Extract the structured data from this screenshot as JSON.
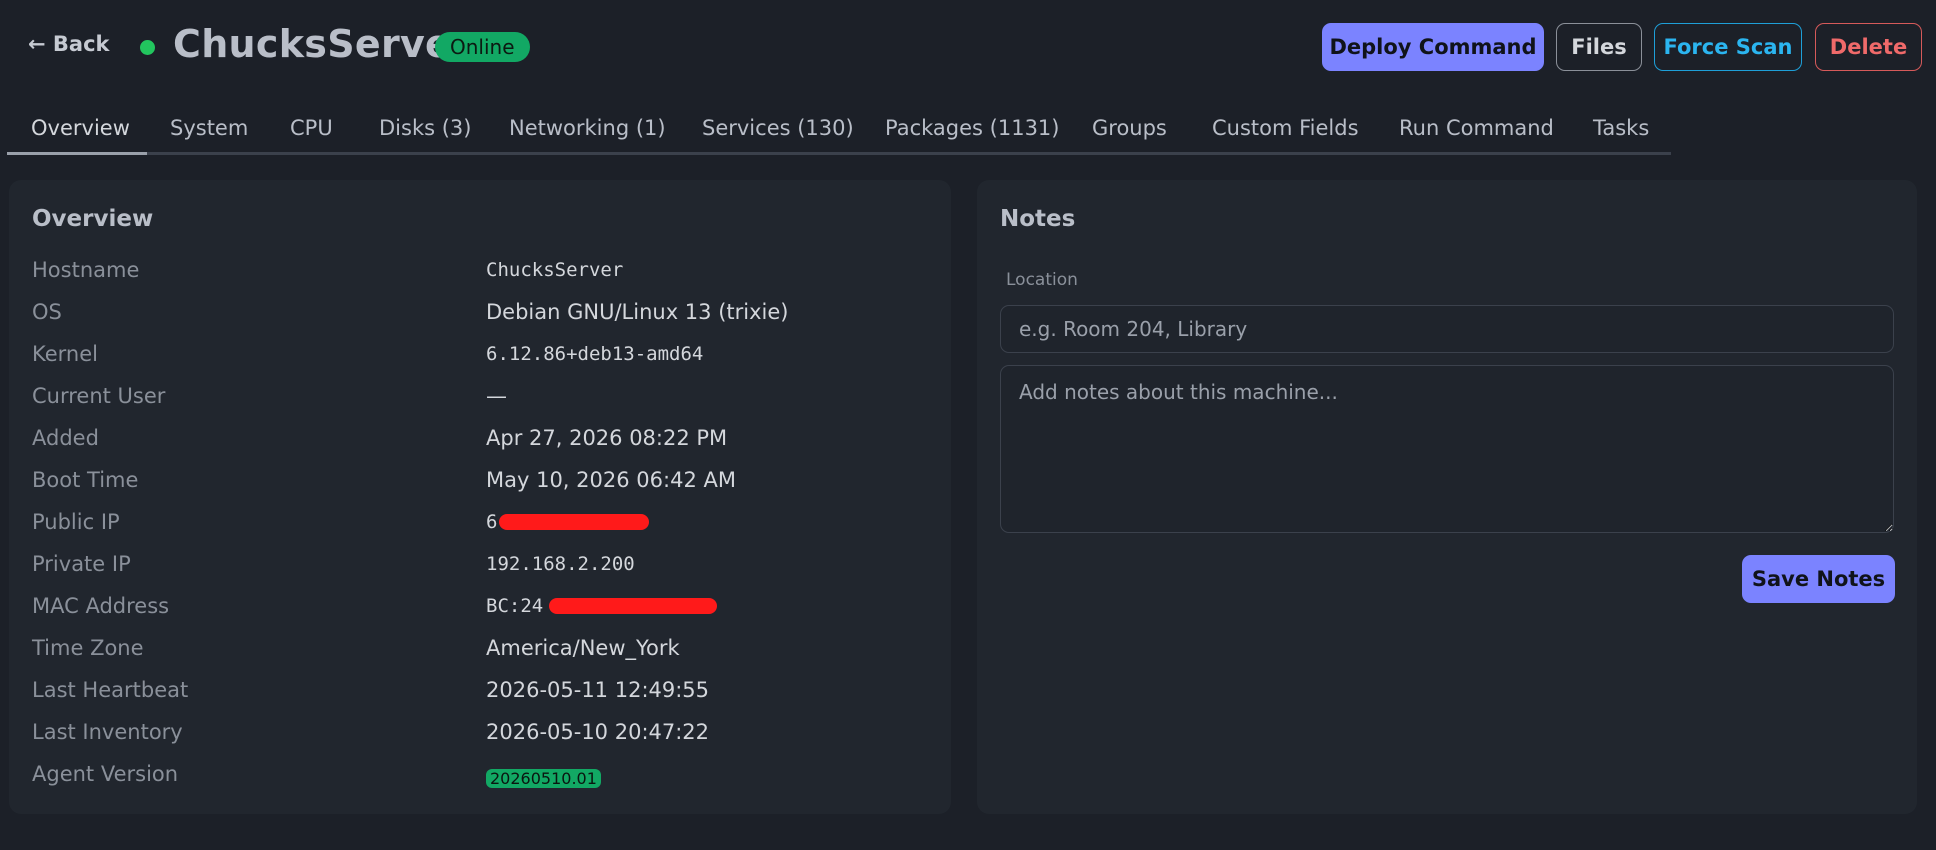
{
  "header": {
    "back_label": "← Back",
    "machine_name": "ChucksServer",
    "status": "Online",
    "status_color": "#22c55e",
    "actions": {
      "deploy": "Deploy Command",
      "files": "Files",
      "scan": "Force Scan",
      "delete": "Delete"
    }
  },
  "tabs": [
    {
      "label": "Overview",
      "active": true
    },
    {
      "label": "System"
    },
    {
      "label": "CPU"
    },
    {
      "label": "Disks (3)"
    },
    {
      "label": "Networking (1)"
    },
    {
      "label": "Services (130)"
    },
    {
      "label": "Packages (1131)"
    },
    {
      "label": "Groups"
    },
    {
      "label": "Custom Fields"
    },
    {
      "label": "Run Command"
    },
    {
      "label": "Tasks"
    }
  ],
  "overview": {
    "title": "Overview",
    "rows": [
      {
        "label": "Hostname",
        "value": "ChucksServer"
      },
      {
        "label": "OS",
        "value": "Debian GNU/Linux 13 (trixie)"
      },
      {
        "label": "Kernel",
        "value": "6.12.86+deb13-amd64"
      },
      {
        "label": "Current User",
        "value": "—"
      },
      {
        "label": "Added",
        "value": "Apr 27, 2026 08:22 PM"
      },
      {
        "label": "Boot Time",
        "value": "May 10, 2026 06:42 AM"
      },
      {
        "label": "Public IP",
        "value": "6"
      },
      {
        "label": "Private IP",
        "value": "192.168.2.200"
      },
      {
        "label": "MAC Address",
        "value": "BC:24"
      },
      {
        "label": "Time Zone",
        "value": "America/New_York"
      },
      {
        "label": "Last Heartbeat",
        "value": "2026-05-11 12:49:55"
      },
      {
        "label": "Last Inventory",
        "value": "2026-05-10 20:47:22"
      },
      {
        "label": "Agent Version",
        "value": "20260510.01"
      }
    ]
  },
  "notes": {
    "title": "Notes",
    "location_label": "Location",
    "location_placeholder": "e.g. Room 204, Library",
    "notes_placeholder": "Add notes about this machine...",
    "save_label": "Save Notes"
  },
  "colors": {
    "accent": "#7b83ff",
    "online": "#12a864",
    "danger": "#f06a6a",
    "info": "#2bb5f0",
    "redaction": "#ff1a1a"
  }
}
